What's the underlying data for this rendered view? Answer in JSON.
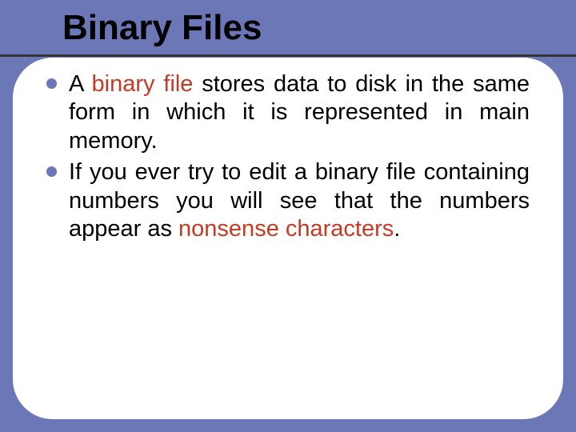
{
  "slide": {
    "title": "Binary Files",
    "bullets": [
      {
        "pre": "A ",
        "hl": "binary file",
        "post": " stores data to disk in the same form in which it is represented in main memory."
      },
      {
        "pre": " If you ever try to edit a binary file containing numbers you will see that the numbers appear as ",
        "hl": "nonsense characters",
        "post": "."
      }
    ]
  }
}
